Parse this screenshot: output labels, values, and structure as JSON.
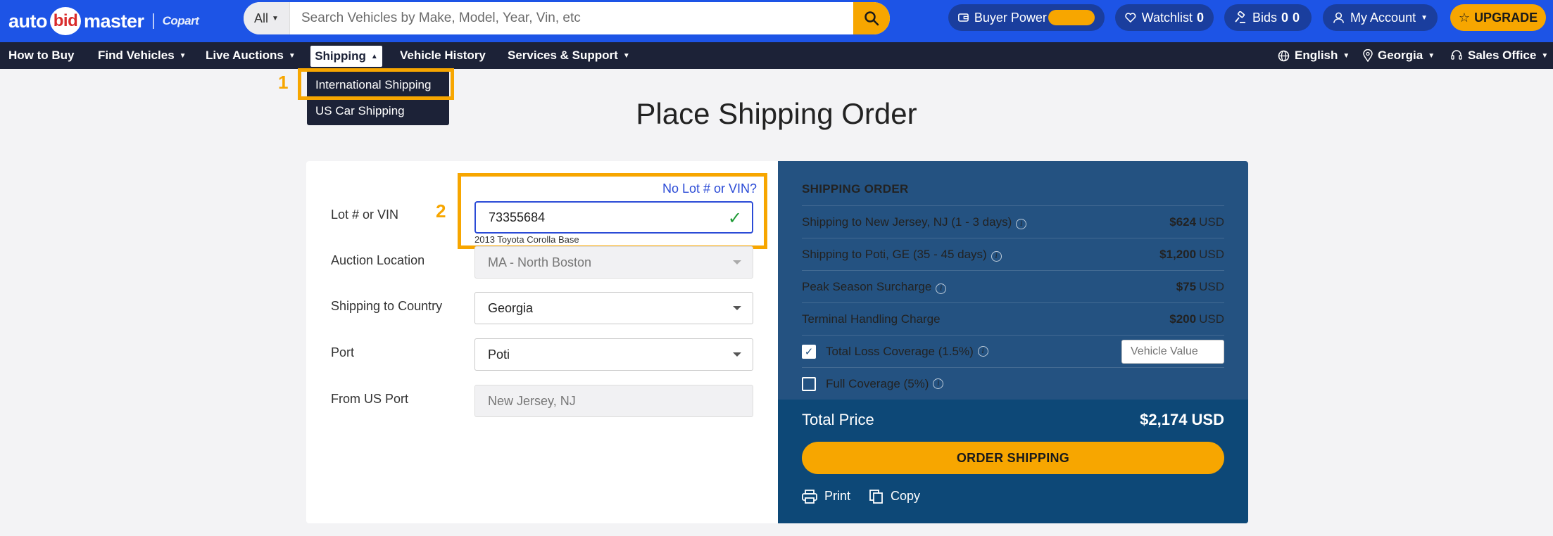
{
  "header": {
    "logo": {
      "part1": "auto",
      "part2": "bid",
      "part3": "master",
      "partner": "Copart"
    },
    "search": {
      "category": "All",
      "placeholder": "Search Vehicles by Make, Model, Year, Vin, etc"
    },
    "buyer_power_label": "Buyer Power",
    "watchlist": {
      "label": "Watchlist",
      "count": "0"
    },
    "bids": {
      "label": "Bids",
      "count_a": "0",
      "count_b": "0"
    },
    "account_label": "My Account",
    "upgrade_label": "UPGRADE"
  },
  "nav": {
    "items": [
      "How to Buy",
      "Find Vehicles",
      "Live Auctions",
      "Shipping",
      "Vehicle History",
      "Services & Support"
    ],
    "language": "English",
    "location": "Georgia",
    "sales_office": "Sales Office"
  },
  "shipping_menu": {
    "items": [
      "International Shipping",
      "US Car Shipping"
    ]
  },
  "annotations": {
    "label1": "1",
    "label2": "2"
  },
  "page_title": "Place Shipping Order",
  "form": {
    "no_lot_link": "No Lot # or VIN?",
    "lot_label": "Lot # or VIN",
    "lot_value": "73355684",
    "vehicle_desc": "2013 Toyota Corolla Base",
    "auction_label": "Auction Location",
    "auction_value": "MA - North Boston",
    "country_label": "Shipping to Country",
    "country_value": "Georgia",
    "port_label": "Port",
    "port_value": "Poti",
    "from_label": "From US Port",
    "from_value": "New Jersey, NJ"
  },
  "order": {
    "title": "SHIPPING ORDER",
    "lines": [
      {
        "label": "Shipping to New Jersey, NJ (1 - 3 days)",
        "amount": "$624",
        "currency": "USD"
      },
      {
        "label": "Shipping to Poti, GE (35 - 45 days)",
        "amount": "$1,200",
        "currency": "USD"
      },
      {
        "label": "Peak Season Surcharge",
        "amount": "$75",
        "currency": "USD"
      },
      {
        "label": "Terminal Handling Charge",
        "amount": "$200",
        "currency": "USD"
      }
    ],
    "total_loss": {
      "label": "Total Loss Coverage (1.5%)",
      "checked": true,
      "placeholder": "Vehicle Value"
    },
    "full_coverage": {
      "label": "Full Coverage (5%)",
      "checked": false
    },
    "total_label": "Total Price",
    "total_value": "$2,174 USD",
    "order_button": "ORDER SHIPPING",
    "print_label": "Print",
    "copy_label": "Copy"
  },
  "colors": {
    "brand_blue": "#1d54e6",
    "accent": "#f7a600",
    "nav": "#1c2237",
    "panel": "#245281",
    "panel_dark": "#0d4877"
  }
}
